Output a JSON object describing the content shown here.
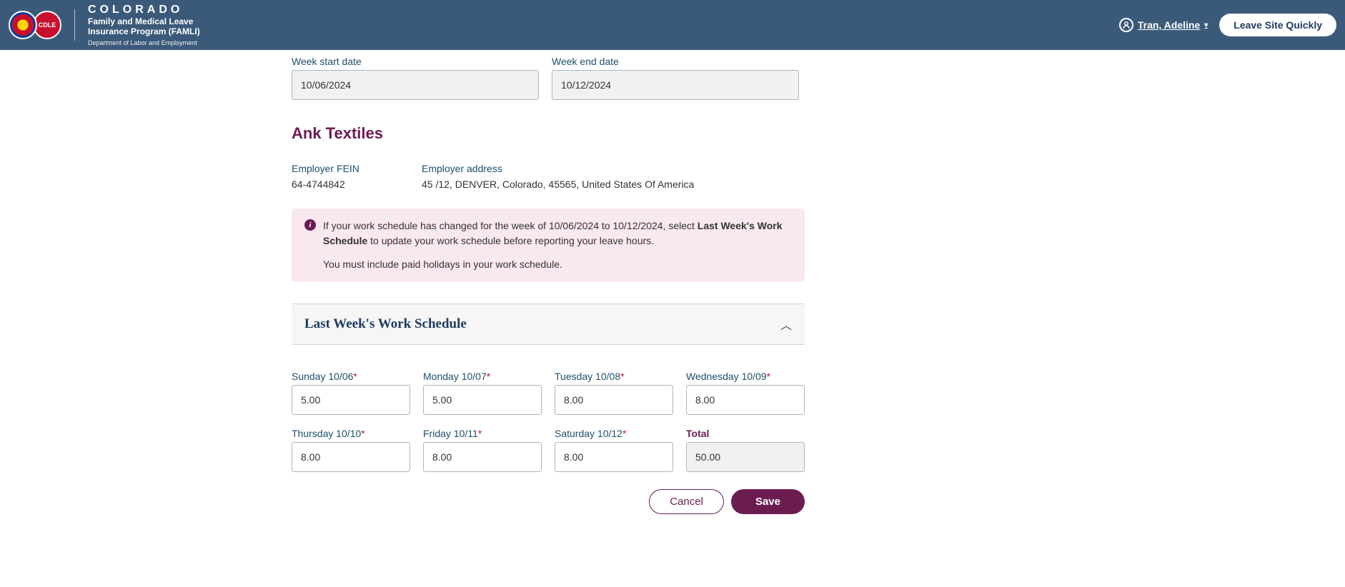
{
  "header": {
    "state": "COLORADO",
    "program_line1": "Family and Medical Leave",
    "program_line2": "Insurance Program (FAMLI)",
    "dept": "Department of Labor and Employment",
    "cdle": "CDLE",
    "user_name": "Tran, Adeline",
    "leave_btn": "Leave Site Quickly"
  },
  "week": {
    "start_label": "Week start date",
    "start_value": "10/06/2024",
    "end_label": "Week end date",
    "end_value": "10/12/2024"
  },
  "employer": {
    "name": "Ank Textiles",
    "fein_label": "Employer FEIN",
    "fein_value": "64-4744842",
    "addr_label": "Employer address",
    "addr_value": "45 /12, DENVER, Colorado, 45565, United States Of America"
  },
  "alert": {
    "prefix": "If your work schedule has changed for the week of 10/06/2024 to 10/12/2024, select ",
    "strong": "Last Week's Work Schedule",
    "suffix": " to update your work schedule before reporting your leave hours.",
    "line2": "You must include paid holidays in your work schedule."
  },
  "accordion": {
    "title": "Last Week's Work Schedule"
  },
  "schedule": {
    "days": [
      {
        "label": "Sunday 10/06",
        "value": "5.00"
      },
      {
        "label": "Monday 10/07",
        "value": "5.00"
      },
      {
        "label": "Tuesday 10/08",
        "value": "8.00"
      },
      {
        "label": "Wednesday 10/09",
        "value": "8.00"
      },
      {
        "label": "Thursday 10/10",
        "value": "8.00"
      },
      {
        "label": "Friday 10/11",
        "value": "8.00"
      },
      {
        "label": "Saturday 10/12",
        "value": "8.00"
      }
    ],
    "total_label": "Total",
    "total_value": "50.00"
  },
  "buttons": {
    "cancel": "Cancel",
    "save": "Save"
  }
}
